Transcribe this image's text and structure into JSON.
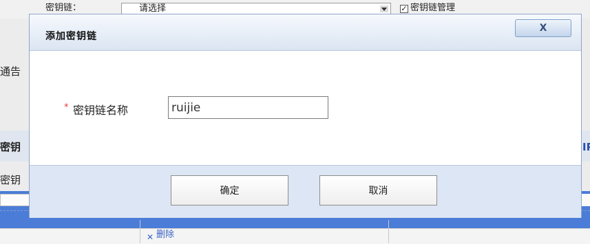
{
  "background": {
    "keychain_label": "密钥链：",
    "select_value": "请选择",
    "keychain_manage_label": "密钥链管理",
    "notice_fragment": "通告",
    "section_fragment": "密钥",
    "row_label_fragment": "密钥",
    "right_fragment": "IP",
    "cancel_button": "取消",
    "confirm_button": "确定",
    "delete_link": "删除"
  },
  "dialog": {
    "title": "添加密钥链",
    "close_label": "X",
    "required_mark": "*",
    "field_label": "密钥链名称",
    "field_value": "ruijie",
    "confirm_label": "确定",
    "cancel_label": "取消"
  },
  "colors": {
    "dialog_border": "#8fa4c4",
    "footer_bg": "#dde6f4",
    "overlay_strip": "#4a7cd8",
    "required": "#e23a3a"
  }
}
